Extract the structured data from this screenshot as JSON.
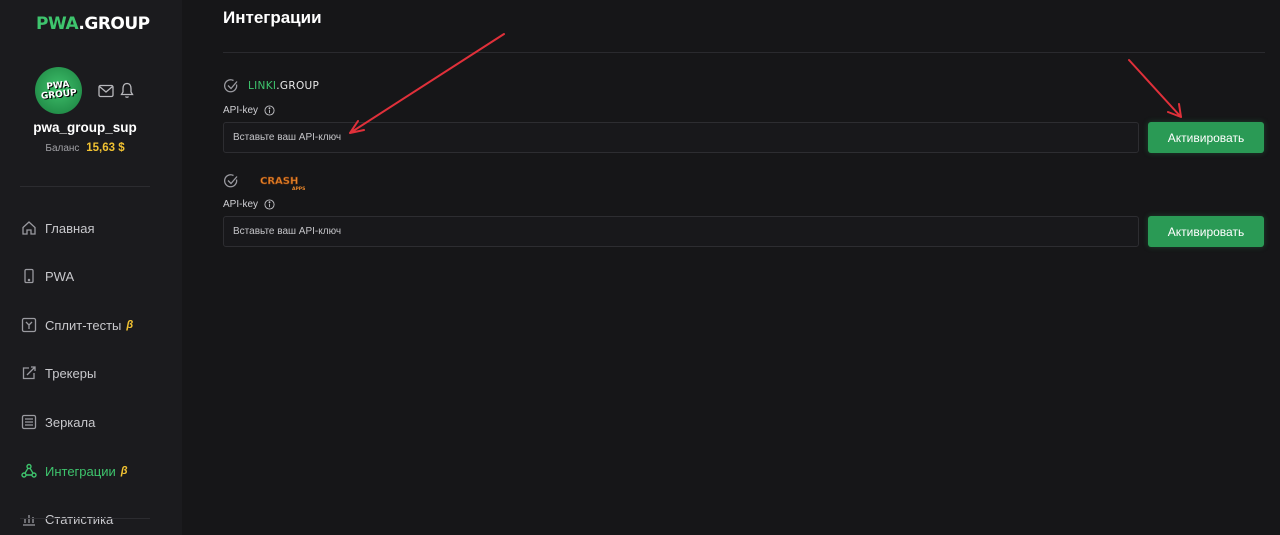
{
  "sidebar": {
    "logo_part1": "PWA",
    "logo_part2": ".GROUP",
    "avatar_text": "PWA GROUP",
    "username": "pwa_group_sup",
    "balance_label": "Баланс",
    "balance_value": "15,63 $",
    "nav": [
      {
        "label": "Главная",
        "icon": "home-icon"
      },
      {
        "label": "PWA",
        "icon": "phone-icon"
      },
      {
        "label": "Сплит-тесты",
        "icon": "split-icon",
        "beta": "β"
      },
      {
        "label": "Трекеры",
        "icon": "share-icon"
      },
      {
        "label": "Зеркала",
        "icon": "mirror-icon"
      },
      {
        "label": "Интеграции",
        "icon": "integrations-icon",
        "beta": "β",
        "active": true
      },
      {
        "label": "Статистика",
        "icon": "chart-icon"
      }
    ]
  },
  "main": {
    "title": "Интеграции",
    "integrations": [
      {
        "logo_green": "LINKI",
        "logo_white": ".GROUP",
        "key_label": "API-key",
        "placeholder": "Вставьте ваш API-ключ",
        "button": "Активировать"
      },
      {
        "logo_text": "CRASH",
        "logo_sub": "APPS",
        "key_label": "API-key",
        "placeholder": "Вставьте ваш API-ключ",
        "button": "Активировать"
      }
    ]
  },
  "colors": {
    "accent": "#3ec46d",
    "button": "#2a9a55",
    "balance": "#f1c232",
    "annotation_arrow": "#e0303a"
  }
}
